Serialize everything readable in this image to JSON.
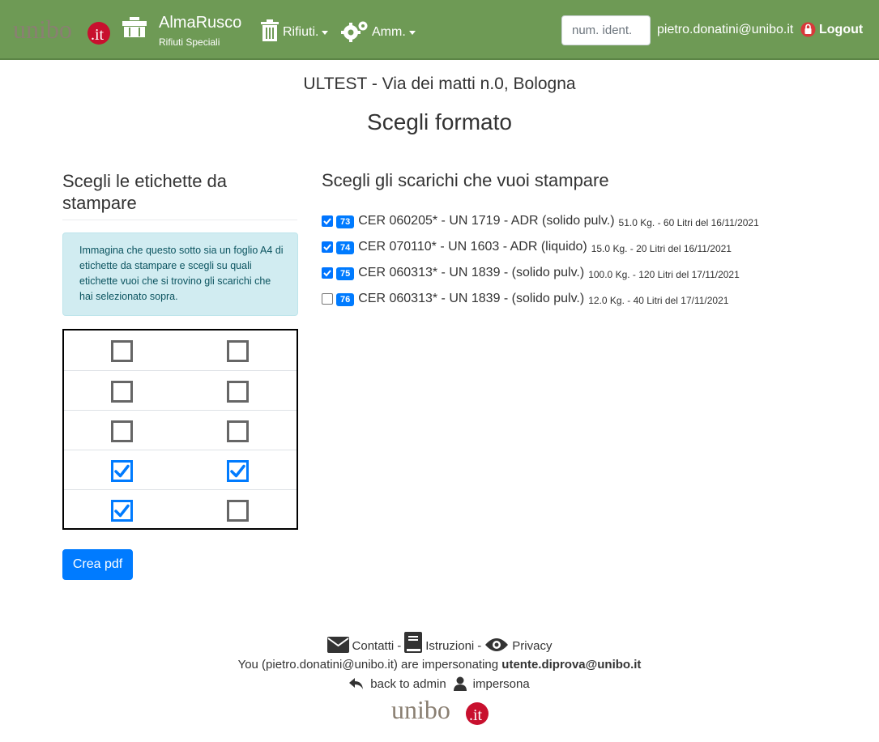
{
  "navbar": {
    "logo_text": "unibo.it",
    "app_title": "AlmaRusco",
    "app_subtitle": "Rifiuti Speciali",
    "menu_rifiuti": "Rifiuti.",
    "menu_amm": "Amm.",
    "search_placeholder": "num. ident.",
    "user_email": "pietro.donatini@unibo.it",
    "logout_label": "Logout"
  },
  "site_line": "ULTEST - Via dei matti n.0, Bologna",
  "page_title": "Scegli formato",
  "labels_panel": {
    "heading": "Scegli le etichette da stampare",
    "info_text": "Immagina che questo sotto sia un foglio A4 di etichette da stampare e scegli su quali etichette vuoi che si trovino gli scarichi che hai selezionato sopra.",
    "grid": [
      [
        false,
        false
      ],
      [
        false,
        false
      ],
      [
        false,
        false
      ],
      [
        true,
        true
      ],
      [
        true,
        false
      ]
    ],
    "create_button": "Crea pdf"
  },
  "shipments_panel": {
    "heading": "Scegli gli scarichi che vuoi stampare",
    "items": [
      {
        "checked": true,
        "badge": "73",
        "main": "CER 060205* - UN 1719 - ADR (solido pulv.)",
        "detail": "51.0 Kg. - 60 Litri del 16/11/2021"
      },
      {
        "checked": true,
        "badge": "74",
        "main": "CER 070110* - UN 1603 - ADR (liquido)",
        "detail": "15.0 Kg. - 20 Litri del 16/11/2021"
      },
      {
        "checked": true,
        "badge": "75",
        "main": "CER 060313* - UN 1839 - (solido pulv.)",
        "detail": "100.0 Kg. - 120 Litri del 17/11/2021"
      },
      {
        "checked": false,
        "badge": "76",
        "main": "CER 060313* - UN 1839 - (solido pulv.)",
        "detail": "12.0 Kg. - 40 Litri del 17/11/2021"
      }
    ]
  },
  "footer": {
    "contatti": "Contatti",
    "istruzioni": "Istruzioni",
    "privacy": "Privacy",
    "separator": "-",
    "impersonation_prefix": "You (pietro.donatini@unibo.it) are impersonating",
    "impersonated_user": "utente.diprova@unibo.it",
    "back_to_admin": "back to admin",
    "impersona": "impersona",
    "logo_text": "unibo.it"
  },
  "colors": {
    "navbar_bg": "#6e9a55",
    "primary": "#007bff",
    "info_bg": "#d1ecf1",
    "logo_red": "#c8102e"
  }
}
